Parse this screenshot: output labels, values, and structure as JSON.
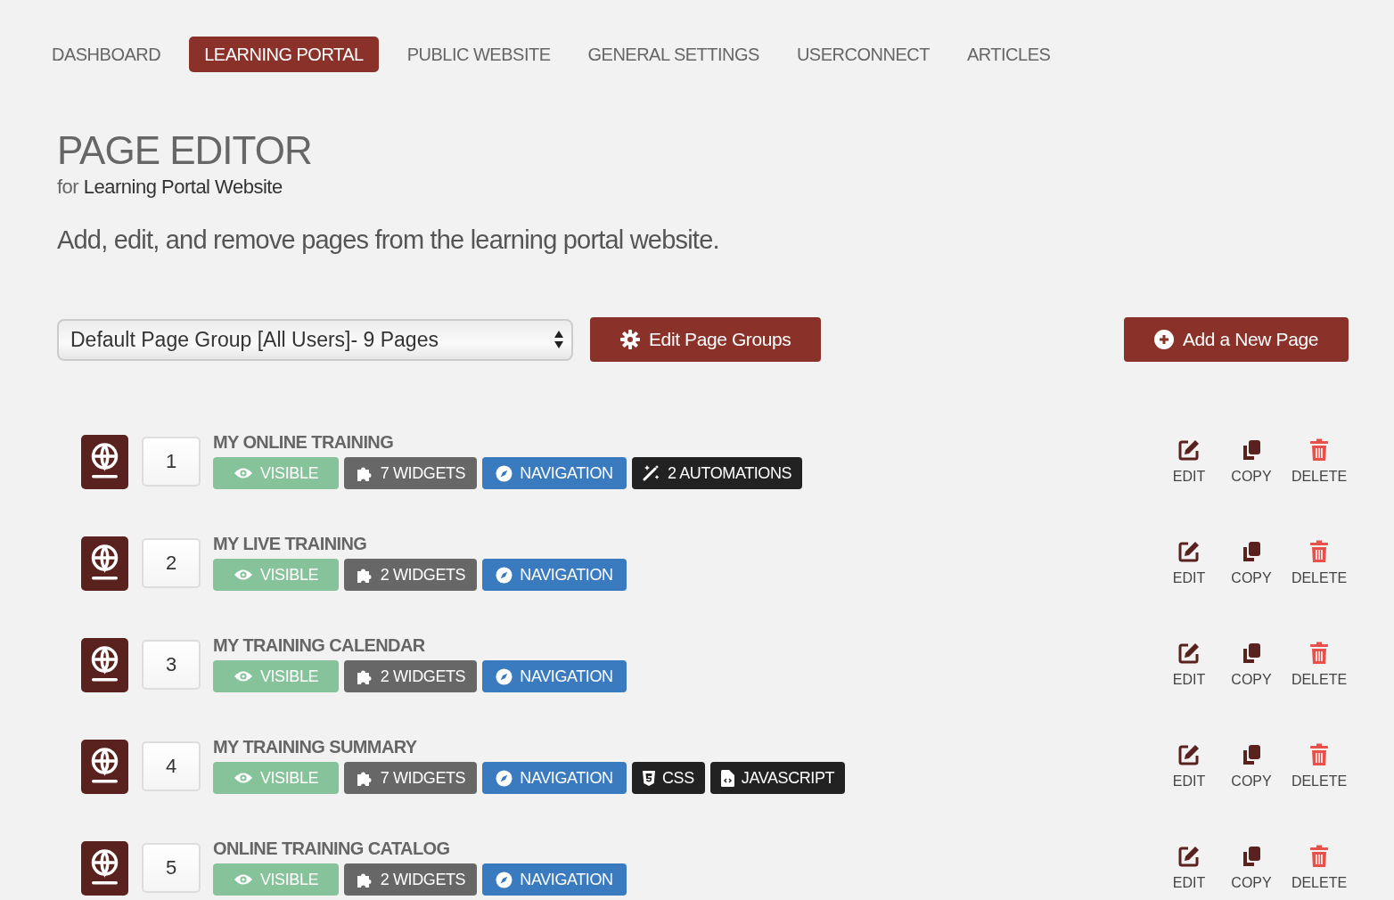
{
  "tabs": [
    {
      "label": "DASHBOARD",
      "selected": false
    },
    {
      "label": "LEARNING PORTAL",
      "selected": true
    },
    {
      "label": "PUBLIC WEBSITE",
      "selected": false
    },
    {
      "label": "GENERAL SETTINGS",
      "selected": false
    },
    {
      "label": "USERCONNECT",
      "selected": false
    },
    {
      "label": "ARTICLES",
      "selected": false
    }
  ],
  "heading": "PAGE EDITOR",
  "subheading": "for **Learning Portal Website**",
  "description": "Add, edit, and remove pages from the learning portal website.",
  "page_group_select": {
    "value": "Default Page Group [All Users]- 9 Pages"
  },
  "edit_groups_button": "Edit Page Groups",
  "add_page_button": "Add a New Page",
  "pages": [
    {
      "number": "1",
      "title": "MY ONLINE TRAINING",
      "badges": [
        {
          "kind": "visible",
          "label": "VISIBLE"
        },
        {
          "kind": "widgets",
          "label": "7 WIDGETS"
        },
        {
          "kind": "navigation",
          "label": "NAVIGATION"
        },
        {
          "kind": "automations",
          "label": "2 AUTOMATIONS"
        }
      ],
      "actions": [
        {
          "kind": "edit",
          "label": "EDIT"
        },
        {
          "kind": "copy",
          "label": "COPY"
        },
        {
          "kind": "delete",
          "label": "DELETE"
        }
      ]
    },
    {
      "number": "2",
      "title": "MY LIVE TRAINING",
      "badges": [
        {
          "kind": "visible",
          "label": "VISIBLE"
        },
        {
          "kind": "widgets",
          "label": "2 WIDGETS"
        },
        {
          "kind": "navigation",
          "label": "NAVIGATION"
        }
      ],
      "actions": [
        {
          "kind": "edit",
          "label": "EDIT"
        },
        {
          "kind": "copy",
          "label": "COPY"
        },
        {
          "kind": "delete",
          "label": "DELETE"
        }
      ]
    },
    {
      "number": "3",
      "title": "MY TRAINING CALENDAR",
      "badges": [
        {
          "kind": "visible",
          "label": "VISIBLE"
        },
        {
          "kind": "widgets",
          "label": "2 WIDGETS"
        },
        {
          "kind": "navigation",
          "label": "NAVIGATION"
        }
      ],
      "actions": [
        {
          "kind": "edit",
          "label": "EDIT"
        },
        {
          "kind": "copy",
          "label": "COPY"
        },
        {
          "kind": "delete",
          "label": "DELETE"
        }
      ]
    },
    {
      "number": "4",
      "title": "MY TRAINING SUMMARY",
      "badges": [
        {
          "kind": "visible",
          "label": "VISIBLE"
        },
        {
          "kind": "widgets",
          "label": "7 WIDGETS"
        },
        {
          "kind": "navigation",
          "label": "NAVIGATION"
        },
        {
          "kind": "css",
          "label": "CSS"
        },
        {
          "kind": "javascript",
          "label": "JAVASCRIPT"
        }
      ],
      "actions": [
        {
          "kind": "edit",
          "label": "EDIT"
        },
        {
          "kind": "copy",
          "label": "COPY"
        },
        {
          "kind": "delete",
          "label": "DELETE"
        }
      ]
    },
    {
      "number": "5",
      "title": "ONLINE TRAINING CATALOG",
      "badges": [
        {
          "kind": "visible",
          "label": "VISIBLE"
        },
        {
          "kind": "widgets",
          "label": "2 WIDGETS"
        },
        {
          "kind": "navigation",
          "label": "NAVIGATION"
        }
      ],
      "actions": [
        {
          "kind": "edit",
          "label": "EDIT"
        },
        {
          "kind": "copy",
          "label": "COPY"
        },
        {
          "kind": "delete",
          "label": "DELETE"
        }
      ]
    }
  ]
}
